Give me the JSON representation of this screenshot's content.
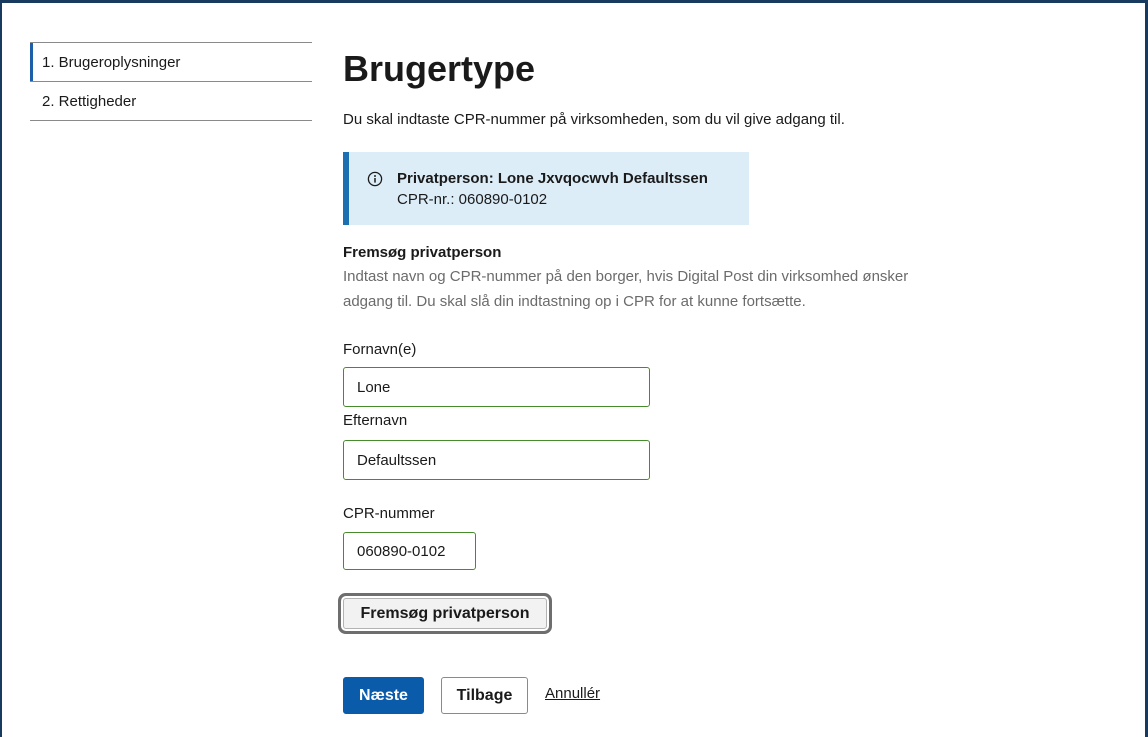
{
  "colors": {
    "frame": "#173a5e",
    "step_accent": "#1f5fa8",
    "info_bg": "#dcedf8",
    "info_accent": "#1c6fb1",
    "input_valid_border": "#478c2c",
    "primary": "#0b5bab",
    "text": "#1a1a1a",
    "muted_text": "#6b6b6b"
  },
  "steps": [
    {
      "label": "1. Brugeroplysninger",
      "active": true
    },
    {
      "label": "2. Rettigheder",
      "active": false
    }
  ],
  "page": {
    "title": "Brugertype",
    "intro": "Du skal indtaste CPR-nummer på virksomheden, som du vil give adgang til."
  },
  "info_box": {
    "icon": "info-icon",
    "heading": "Privatperson: Lone Jxvqocwvh Defaultssen",
    "detail": "CPR-nr.: 060890-0102"
  },
  "search": {
    "heading": "Fremsøg privatperson",
    "description": "Indtast navn og CPR-nummer på den borger, hvis Digital Post din virksomhed ønsker adgang til. Du skal slå din indtastning op i CPR for at kunne fortsætte.",
    "fields": {
      "first_name": {
        "label": "Fornavn(e)",
        "value": "Lone"
      },
      "last_name": {
        "label": "Efternavn",
        "value": "Defaultssen"
      },
      "cpr": {
        "label": "CPR-nummer",
        "value": "060890-0102"
      }
    },
    "button_label": "Fremsøg privatperson"
  },
  "actions": {
    "next_label": "Næste",
    "back_label": "Tilbage",
    "cancel_label": "Annullér"
  }
}
